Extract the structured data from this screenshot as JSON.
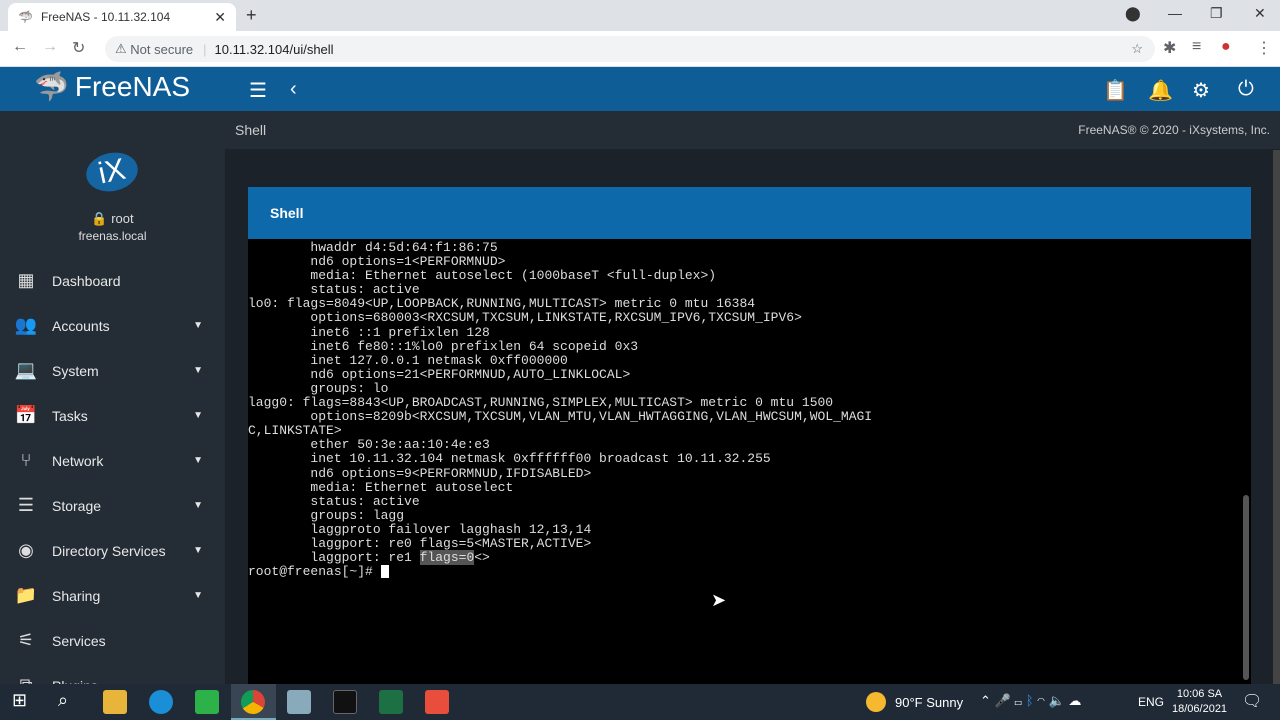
{
  "browser": {
    "tab_title": "FreeNAS - 10.11.32.104",
    "security": "Not secure",
    "url": "10.11.32.104/ui/shell"
  },
  "app": {
    "brand": "FreeNAS",
    "user": "root",
    "host": "freenas.local",
    "logo_text": "iX",
    "page_title": "Shell",
    "copyright": "FreeNAS® © 2020 - iXsystems, Inc."
  },
  "sidebar": {
    "items": [
      {
        "label": "Dashboard",
        "icon": "dashboard-icon",
        "caret": false
      },
      {
        "label": "Accounts",
        "icon": "accounts-icon",
        "caret": true
      },
      {
        "label": "System",
        "icon": "laptop-icon",
        "caret": true
      },
      {
        "label": "Tasks",
        "icon": "calendar-icon",
        "caret": true
      },
      {
        "label": "Network",
        "icon": "network-icon",
        "caret": true
      },
      {
        "label": "Storage",
        "icon": "storage-icon",
        "caret": true
      },
      {
        "label": "Directory Services",
        "icon": "directory-icon",
        "caret": true
      },
      {
        "label": "Sharing",
        "icon": "sharing-icon",
        "caret": true
      },
      {
        "label": "Services",
        "icon": "services-icon",
        "caret": false
      },
      {
        "label": "Plugins",
        "icon": "plugins-icon",
        "caret": false
      }
    ]
  },
  "shell": {
    "title": "Shell",
    "lines": [
      "        hwaddr d4:5d:64:f1:86:75",
      "        nd6 options=1<PERFORMNUD>",
      "        media: Ethernet autoselect (1000baseT <full-duplex>)",
      "        status: active",
      "lo0: flags=8049<UP,LOOPBACK,RUNNING,MULTICAST> metric 0 mtu 16384",
      "        options=680003<RXCSUM,TXCSUM,LINKSTATE,RXCSUM_IPV6,TXCSUM_IPV6>",
      "        inet6 ::1 prefixlen 128",
      "        inet6 fe80::1%lo0 prefixlen 64 scopeid 0x3",
      "        inet 127.0.0.1 netmask 0xff000000",
      "        nd6 options=21<PERFORMNUD,AUTO_LINKLOCAL>",
      "        groups: lo",
      "lagg0: flags=8843<UP,BROADCAST,RUNNING,SIMPLEX,MULTICAST> metric 0 mtu 1500",
      "        options=8209b<RXCSUM,TXCSUM,VLAN_MTU,VLAN_HWTAGGING,VLAN_HWCSUM,WOL_MAGI",
      "C,LINKSTATE>",
      "        ether 50:3e:aa:10:4e:e3",
      "        inet 10.11.32.104 netmask 0xffffff00 broadcast 10.11.32.255",
      "        nd6 options=9<PERFORMNUD,IFDISABLED>",
      "        media: Ethernet autoselect",
      "        status: active",
      "        groups: lagg",
      "        laggproto failover lagghash 12,13,14",
      "        laggport: re0 flags=5<MASTER,ACTIVE>"
    ],
    "last_line_prefix": "        laggport: re1 ",
    "last_line_selected": "flags=0",
    "last_line_suffix": "<>",
    "prompt": "root@freenas[~]# "
  },
  "taskbar": {
    "weather": "90°F  Sunny",
    "lang": "ENG",
    "time": "10:06 SA",
    "date": "18/06/2021"
  }
}
